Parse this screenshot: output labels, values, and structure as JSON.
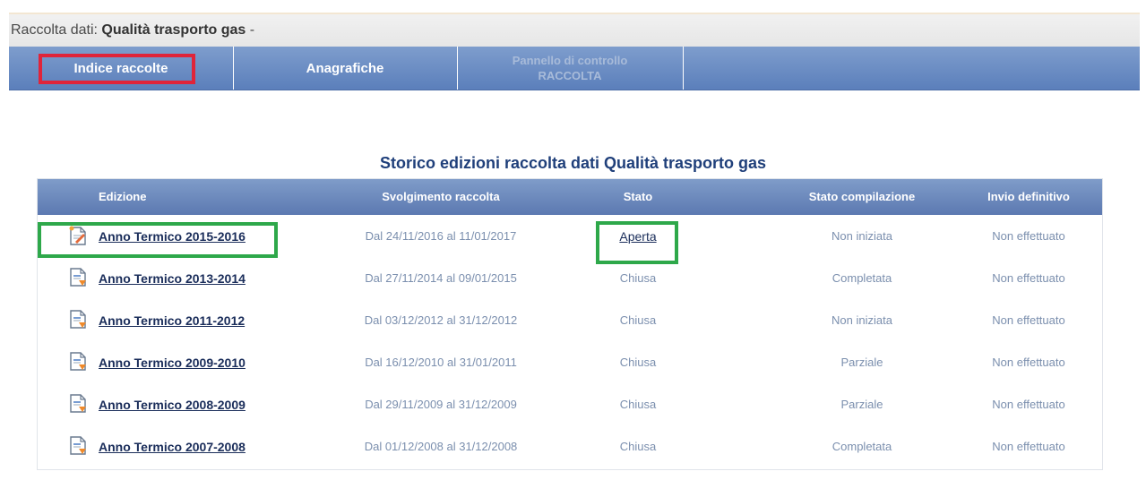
{
  "title_prefix": "Raccolta dati: ",
  "title_name": "Qualità trasporto gas",
  "title_suffix": " -",
  "nav": [
    {
      "label": "Indice raccolte"
    },
    {
      "label": "Anagrafiche"
    },
    {
      "label_line1": "Pannello di controllo",
      "label_line2": "RACCOLTA"
    }
  ],
  "heading": "Storico edizioni raccolta dati Qualità trasporto gas",
  "columns": [
    "Edizione",
    "Svolgimento raccolta",
    "Stato",
    "Stato compilazione",
    "Invio definitivo"
  ],
  "rows": [
    {
      "edizione": "Anno Termico 2015-2016",
      "svolgimento": "Dal 24/11/2016 al 11/01/2017",
      "stato": "Aperta",
      "compilazione": "Non iniziata",
      "invio": "Non effettuato",
      "icon": "document-edit-icon"
    },
    {
      "edizione": "Anno Termico 2013-2014",
      "svolgimento": "Dal 27/11/2014 al 09/01/2015",
      "stato": "Chiusa",
      "compilazione": "Completata",
      "invio": "Non effettuato",
      "icon": "document-closed-icon"
    },
    {
      "edizione": "Anno Termico 2011-2012",
      "svolgimento": "Dal 03/12/2012 al 31/12/2012",
      "stato": "Chiusa",
      "compilazione": "Non iniziata",
      "invio": "Non effettuato",
      "icon": "document-closed-icon"
    },
    {
      "edizione": "Anno Termico 2009-2010",
      "svolgimento": "Dal 16/12/2010 al 31/01/2011",
      "stato": "Chiusa",
      "compilazione": "Parziale",
      "invio": "Non effettuato",
      "icon": "document-closed-icon"
    },
    {
      "edizione": "Anno Termico 2008-2009",
      "svolgimento": "Dal 29/11/2009 al 31/12/2009",
      "stato": "Chiusa",
      "compilazione": "Parziale",
      "invio": "Non effettuato",
      "icon": "document-closed-icon"
    },
    {
      "edizione": "Anno Termico 2007-2008",
      "svolgimento": "Dal 01/12/2008 al 31/12/2008",
      "stato": "Chiusa",
      "compilazione": "Completata",
      "invio": "Non effettuato",
      "icon": "document-closed-icon"
    }
  ],
  "colors": {
    "nav_selected_highlight": "#e0243a",
    "row_highlight": "#2ea84a",
    "header_blue": "#5c79b1"
  }
}
